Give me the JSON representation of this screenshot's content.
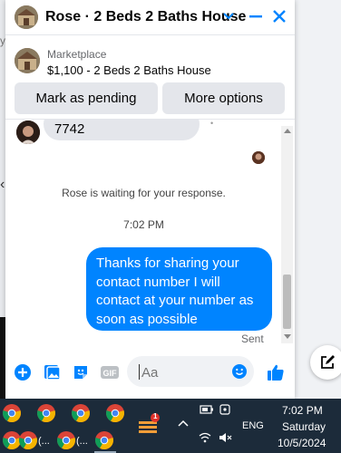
{
  "chat": {
    "title": "Rose · 2 Beds 2 Baths House",
    "listing": {
      "source": "Marketplace",
      "price_title": "$1,100 - 2 Beds 2 Baths House"
    },
    "buttons": {
      "mark_pending": "Mark as pending",
      "more_options": "More options"
    },
    "messages": {
      "incoming_partial": "7742",
      "waiting_notice": "Rose is waiting for your response.",
      "timestamp": "7:02 PM",
      "outgoing": "Thanks for sharing your contact number I will contact at your number as soon as possible",
      "status": "Sent"
    },
    "composer": {
      "placeholder": "Aa"
    },
    "colors": {
      "accent": "#0084ff",
      "bubble_in": "#e4e6eb"
    }
  },
  "taskbar": {
    "apps": [
      {
        "label": "(...",
        "icon": "chrome-icon"
      },
      {
        "label": "(...",
        "icon": "chrome-icon"
      }
    ],
    "language": "ENG",
    "clock": {
      "time": "7:02 PM",
      "day": "Saturday",
      "date": "10/5/2024"
    },
    "notification_badge": "1"
  }
}
